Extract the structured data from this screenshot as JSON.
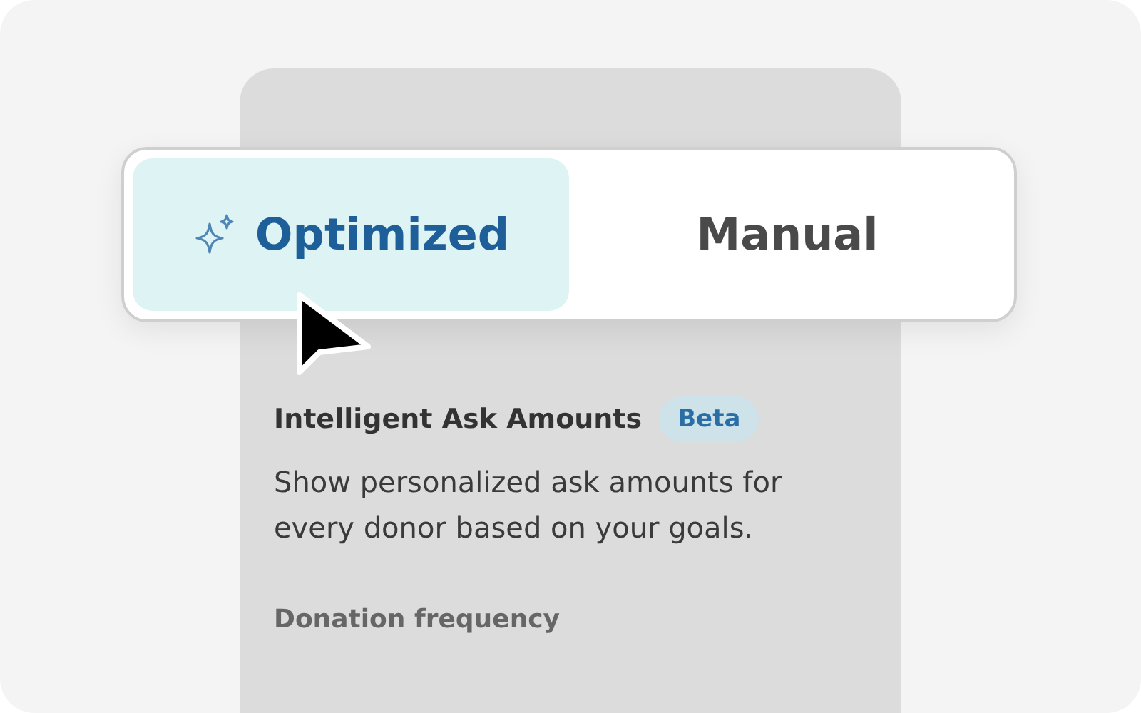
{
  "mode_toggle": {
    "tabs": [
      {
        "label": "Optimized",
        "selected": true,
        "kind": "icon"
      },
      {
        "label": "Manual",
        "selected": false,
        "kind": "text"
      }
    ]
  },
  "settings_panel": {
    "title": "Intelligent Ask Amounts",
    "badge": "Beta",
    "description": "Show personalized ask amounts for every donor based on your goals.",
    "section_label": "Donation frequency"
  }
}
